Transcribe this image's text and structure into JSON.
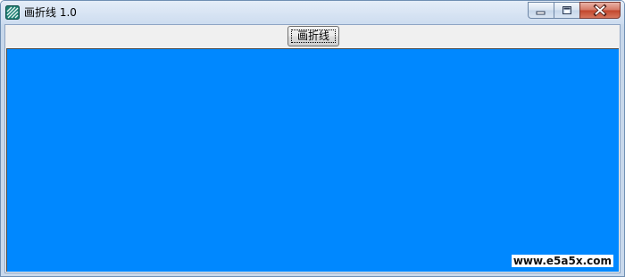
{
  "window": {
    "title": "画折线 1.0",
    "icon": "app-stripes-icon",
    "caption_buttons": [
      "minimize-icon",
      "maximize-icon",
      "close-icon"
    ]
  },
  "toolbar": {
    "draw_button_label": "画折线"
  },
  "canvas": {
    "background_color": "#0088ff"
  },
  "watermark": {
    "text": "www.e5a5x.com"
  }
}
